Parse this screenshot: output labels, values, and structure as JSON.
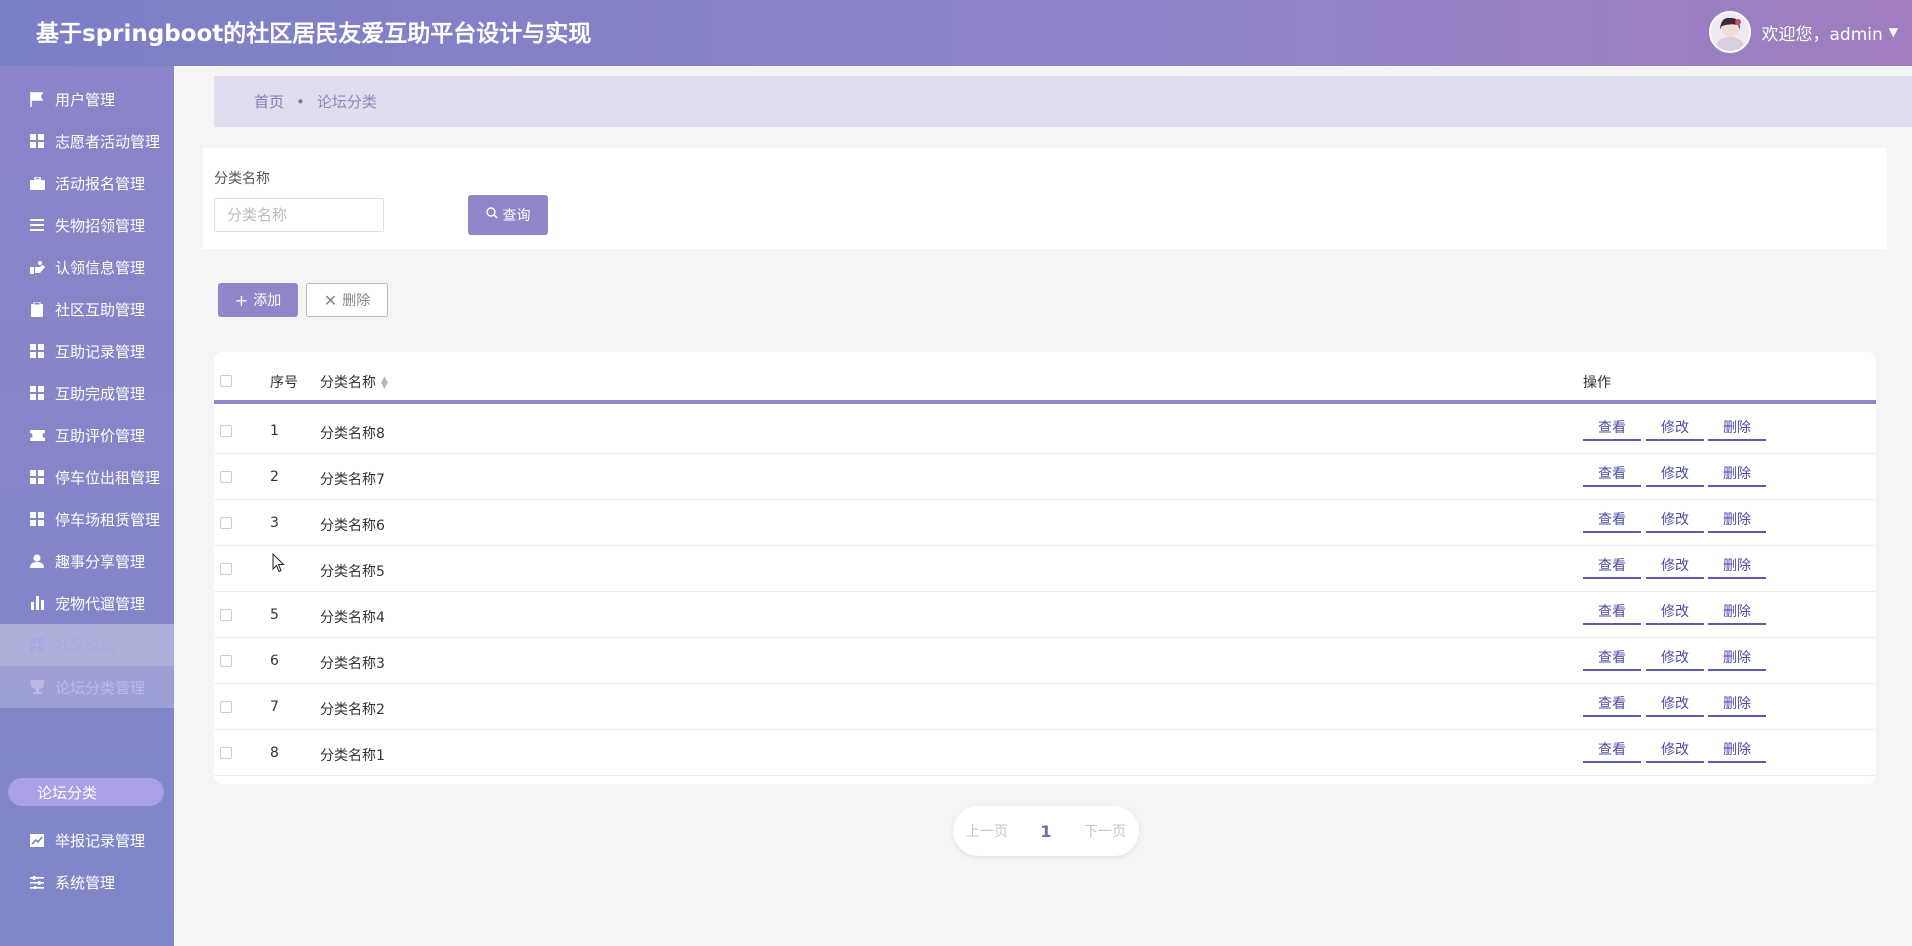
{
  "header": {
    "title": "基于springboot的社区居民友爱互助平台设计与实现",
    "welcome": "欢迎您，admin"
  },
  "sidebar": {
    "items": [
      {
        "label": "用户管理",
        "icon": "flag-icon"
      },
      {
        "label": "志愿者活动管理",
        "icon": "grid-icon"
      },
      {
        "label": "活动报名管理",
        "icon": "briefcase-icon"
      },
      {
        "label": "失物招领管理",
        "icon": "list-icon"
      },
      {
        "label": "认领信息管理",
        "icon": "hand-icon"
      },
      {
        "label": "社区互助管理",
        "icon": "clipboard-icon"
      },
      {
        "label": "互助记录管理",
        "icon": "grid-icon"
      },
      {
        "label": "互助完成管理",
        "icon": "grid-icon"
      },
      {
        "label": "互助评价管理",
        "icon": "ticket-icon"
      },
      {
        "label": "停车位出租管理",
        "icon": "grid-icon"
      },
      {
        "label": "停车场租赁管理",
        "icon": "grid-icon"
      },
      {
        "label": "趣事分享管理",
        "icon": "user-icon"
      },
      {
        "label": "宠物代遛管理",
        "icon": "bar-chart-icon"
      },
      {
        "label": "社区论坛",
        "icon": "grid-icon"
      },
      {
        "label": "论坛分类管理",
        "icon": "cup-icon"
      },
      {
        "label": "举报记录管理",
        "icon": "trend-icon"
      },
      {
        "label": "系统管理",
        "icon": "sliders-icon"
      }
    ],
    "submenu_active": "论坛分类"
  },
  "breadcrumb": {
    "home": "首页",
    "separator": "•",
    "current": "论坛分类"
  },
  "search": {
    "label": "分类名称",
    "placeholder": "分类名称",
    "query_button": "查询"
  },
  "toolbar": {
    "add_label": "添加",
    "delete_label": "删除"
  },
  "table": {
    "headers": {
      "index": "序号",
      "name": "分类名称",
      "actions": "操作"
    },
    "rows": [
      {
        "index": "1",
        "name": "分类名称8"
      },
      {
        "index": "2",
        "name": "分类名称7"
      },
      {
        "index": "3",
        "name": "分类名称6"
      },
      {
        "index": "",
        "name": "分类名称5"
      },
      {
        "index": "5",
        "name": "分类名称4"
      },
      {
        "index": "6",
        "name": "分类名称3"
      },
      {
        "index": "7",
        "name": "分类名称2"
      },
      {
        "index": "8",
        "name": "分类名称1"
      }
    ],
    "actions": {
      "view": "查看",
      "edit": "修改",
      "delete": "删除"
    }
  },
  "pagination": {
    "prev": "上一页",
    "current": "1",
    "next": "下一页"
  },
  "colors": {
    "accent": "#8f87c9",
    "header_start": "#7b7fc6",
    "header_end": "#a07dc0",
    "action_link": "#4c4caa"
  }
}
